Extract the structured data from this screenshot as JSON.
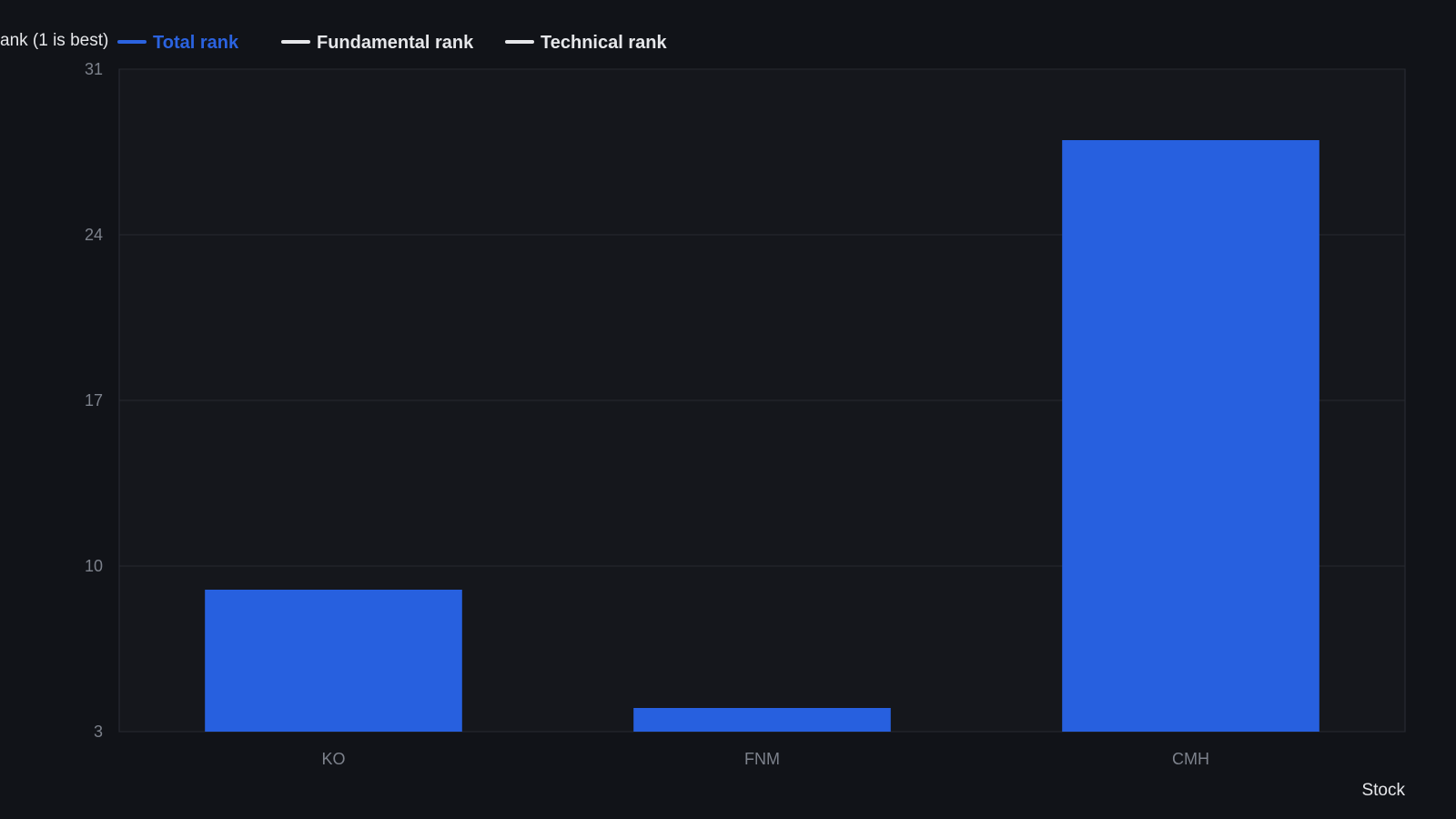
{
  "colors": {
    "page_background": "#111318",
    "plot_background": "#15171c",
    "grid": "#262a31",
    "plot_border": "#2a2e36",
    "tick_label": "#7d828c",
    "axis_title": "#e6e7ea",
    "legend_active": "#2b63e0",
    "legend_inactive": "#e6e7ea",
    "bar": "#2760df"
  },
  "chart_data": {
    "type": "bar",
    "categories": [
      "KO",
      "FNM",
      "CMH"
    ],
    "series": [
      {
        "name": "Total rank",
        "values": [
          9,
          4,
          28
        ]
      }
    ],
    "legend": [
      {
        "name": "Total rank",
        "active": true
      },
      {
        "name": "Fundamental rank",
        "active": false
      },
      {
        "name": "Technical rank",
        "active": false
      }
    ],
    "legend_position": "top-left",
    "ylabel": "ank (1 is best)",
    "xlabel": "Stock",
    "ylim": [
      3,
      31
    ],
    "yticks": [
      3,
      10,
      17,
      24,
      31
    ],
    "grid": true
  }
}
